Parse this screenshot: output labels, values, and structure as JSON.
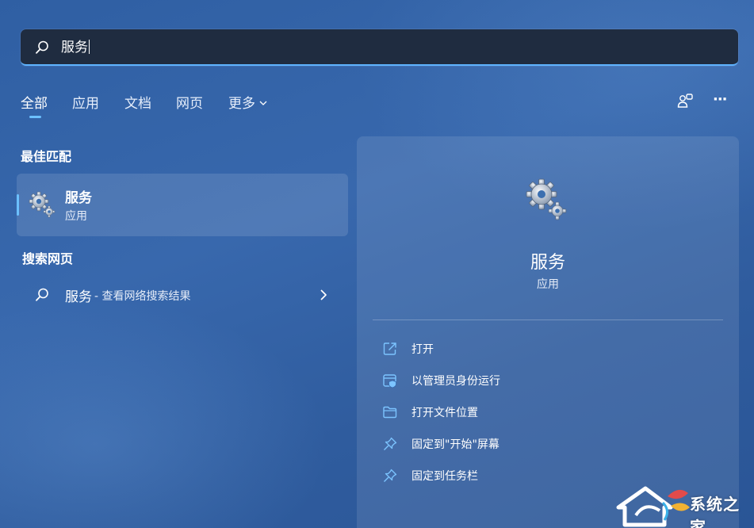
{
  "search": {
    "value": "服务",
    "icon": "search-icon"
  },
  "tabs": [
    {
      "label": "全部",
      "active": true
    },
    {
      "label": "应用"
    },
    {
      "label": "文档"
    },
    {
      "label": "网页"
    },
    {
      "label": "更多"
    }
  ],
  "toolbar": {
    "icons": [
      "account-switch-icon",
      "more-options-icon"
    ],
    "more_glyph": "···"
  },
  "best_match": {
    "heading": "最佳匹配",
    "name": "服务",
    "type": "应用",
    "icon": "services-gear-icon"
  },
  "web_search": {
    "heading": "搜索网页",
    "query": "服务",
    "suffix": "- 查看网络搜索结果"
  },
  "detail": {
    "name": "服务",
    "type": "应用",
    "actions": [
      {
        "label": "打开",
        "icon": "open-external-icon"
      },
      {
        "label": "以管理员身份运行",
        "icon": "admin-shield-icon"
      },
      {
        "label": "打开文件位置",
        "icon": "folder-icon"
      },
      {
        "label": "固定到\"开始\"屏幕",
        "icon": "pin-icon"
      },
      {
        "label": "固定到任务栏",
        "icon": "pin-icon"
      }
    ]
  },
  "watermark": {
    "text": "系统之家"
  },
  "colors": {
    "accent": "#6cc0ff",
    "search_bg": "#1f2c40",
    "background": "#3466aa"
  }
}
